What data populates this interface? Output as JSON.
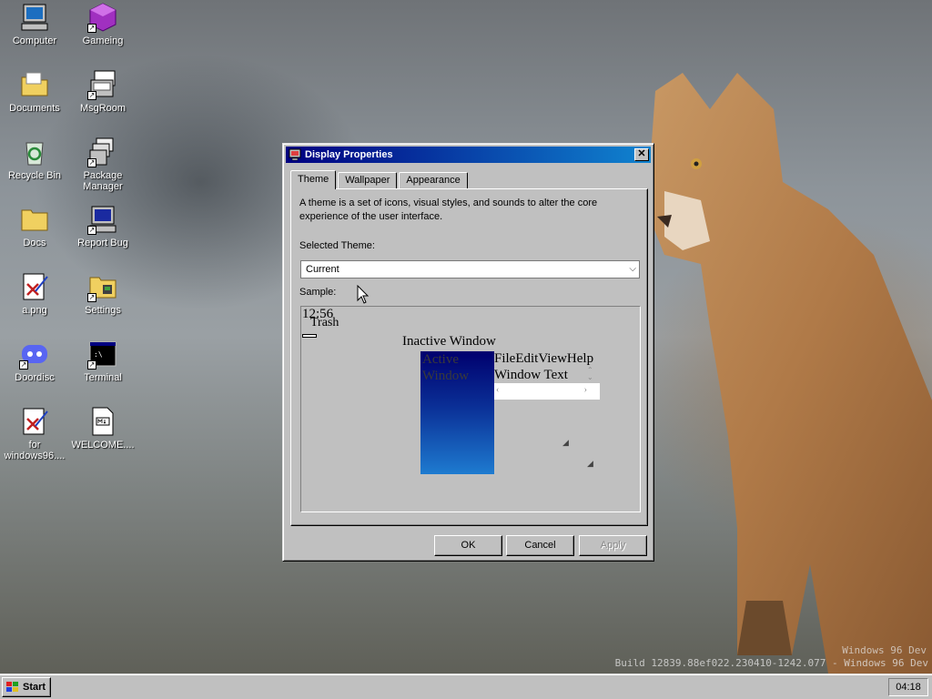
{
  "desktop": {
    "icons": [
      {
        "label": "Computer"
      },
      {
        "label": "Gameing"
      },
      {
        "label": "Documents"
      },
      {
        "label": "MsgRoom"
      },
      {
        "label": "Recycle Bin"
      },
      {
        "label": "Package Manager"
      },
      {
        "label": "Docs"
      },
      {
        "label": "Report Bug"
      },
      {
        "label": "a.png"
      },
      {
        "label": "Settings"
      },
      {
        "label": "Doordisc"
      },
      {
        "label": "Terminal"
      },
      {
        "label": "for windows96...."
      },
      {
        "label": "WELCOME...."
      }
    ],
    "build_text": "Build 12839.88ef022.230410-1242.077 - Windows 96 Dev",
    "winver_text": "Windows 96 Dev"
  },
  "dialog": {
    "title": "Display Properties",
    "close_glyph": "✕",
    "tabs": [
      {
        "label": "Theme"
      },
      {
        "label": "Wallpaper"
      },
      {
        "label": "Appearance"
      }
    ],
    "description": "A theme is a set of icons, visual styles, and sounds to alter the core experience of the user interface.",
    "selected_theme_label": "Selected Theme:",
    "selected_theme_value": "Current",
    "sample_label": "Sample:",
    "sample": {
      "clock": "12:56",
      "trash": "Trash",
      "inactive_window": "Inactive Window",
      "active_window_line1": "Active",
      "active_window_line2": "Window",
      "menu_bar": "FileEditViewHelp",
      "window_text": "Window Text"
    },
    "buttons": {
      "ok": "OK",
      "cancel": "Cancel",
      "apply": "Apply"
    }
  },
  "taskbar": {
    "start_label": "Start",
    "clock": "04:18"
  },
  "colors": {
    "title_start": "#000080",
    "title_end": "#1084d0",
    "face": "#c0c0c0"
  }
}
